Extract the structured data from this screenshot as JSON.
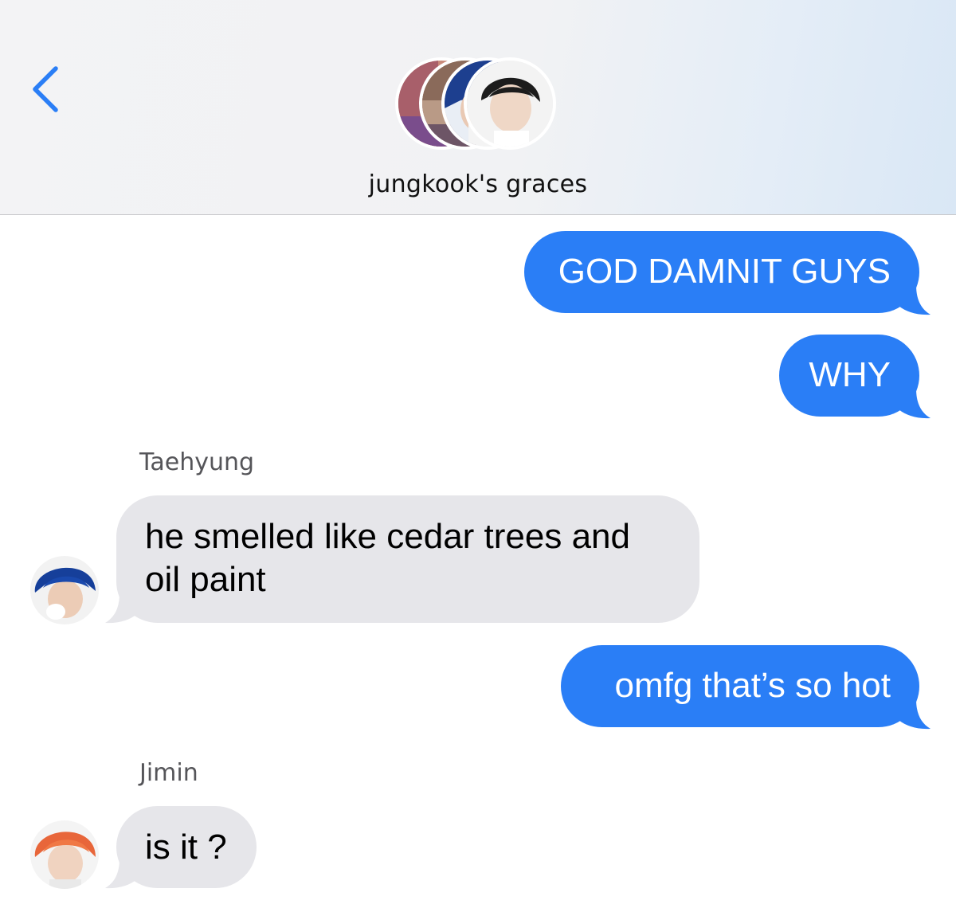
{
  "header": {
    "group_name": "jungkook's graces",
    "back_icon": "chevron-left-icon",
    "accent": "#2a7ef6"
  },
  "messages": [
    {
      "direction": "outgoing",
      "text": "GOD DAMNIT GUYS"
    },
    {
      "direction": "outgoing",
      "text": "WHY"
    },
    {
      "direction": "incoming",
      "sender": "Taehyung",
      "lines": [
        "he smelled like cedar trees and",
        "oil paint"
      ]
    },
    {
      "direction": "outgoing",
      "text": "omfg that’s so hot"
    },
    {
      "direction": "incoming",
      "sender": "Jimin",
      "text": "is it ?"
    }
  ],
  "colors": {
    "outgoing_bubble": "#2a7ef6",
    "incoming_bubble": "#e6e6ea",
    "sender_name": "#555559"
  }
}
